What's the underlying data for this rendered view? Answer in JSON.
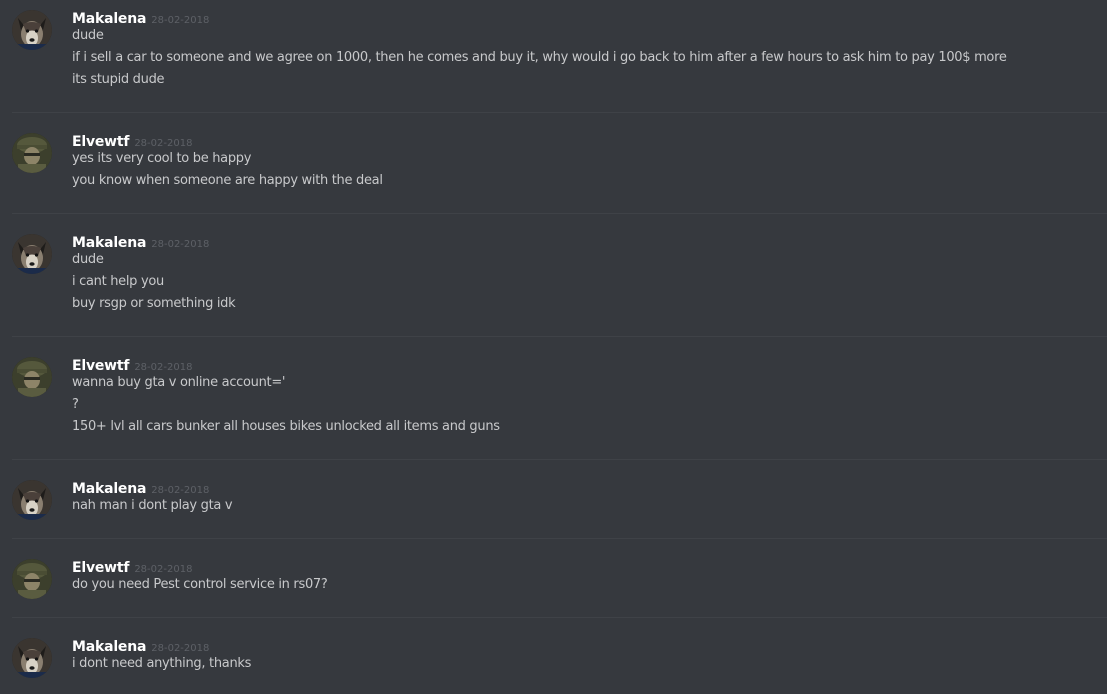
{
  "messages": [
    {
      "author": "Makalena",
      "timestamp": "28-02-2018",
      "lines": [
        "dude",
        "if i sell a car to someone and we agree on 1000, then he comes and buy it, why would i go back to him after a few hours to ask him to pay 100$ more",
        "its stupid dude"
      ]
    },
    {
      "author": "Elvewtf",
      "timestamp": "28-02-2018",
      "lines": [
        "yes its very cool to be happy",
        "you know when someone are happy with the deal"
      ]
    },
    {
      "author": "Makalena",
      "timestamp": "28-02-2018",
      "lines": [
        "dude",
        "i cant help you",
        "buy rsgp or something idk"
      ]
    },
    {
      "author": "Elvewtf",
      "timestamp": "28-02-2018",
      "lines": [
        "wanna buy gta v online account='",
        "?",
        "150+ lvl all cars bunker all houses bikes unlocked all items and guns"
      ]
    },
    {
      "author": "Makalena",
      "timestamp": "28-02-2018",
      "lines": [
        "nah man i  dont play gta v"
      ]
    },
    {
      "author": "Elvewtf",
      "timestamp": "28-02-2018",
      "lines": [
        "do you need Pest control service in rs07?"
      ]
    },
    {
      "author": "Makalena",
      "timestamp": "28-02-2018",
      "lines": [
        "i dont need anything, thanks"
      ]
    }
  ],
  "avatars": {
    "Makalena": "dog-avatar",
    "Elvewtf": "soldier-avatar"
  },
  "colors": {
    "background": "#36393e",
    "divider": "#3f4247",
    "username": "#ffffff",
    "timestamp": "#5d6066",
    "message_text": "#c8c9cb"
  }
}
